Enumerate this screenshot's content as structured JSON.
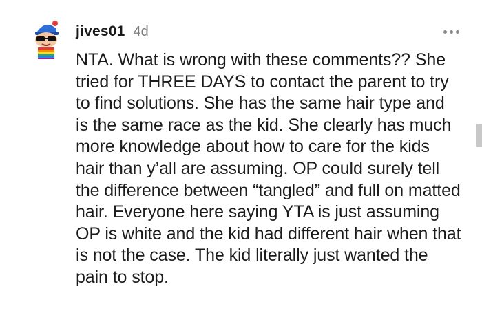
{
  "comment": {
    "username": "jives01",
    "timestamp": "4d",
    "avatar_icon": "snoo-avatar-icon",
    "more_icon": "more-options-icon",
    "text": "NTA. What is wrong with these comments?? She tried for THREE DAYS to contact the parent to try to find solutions. She has the same hair type and is the same race as the kid. She clearly has much more knowledge about how to care for the kids hair than y’all are assuming. OP could surely tell the difference between “tangled” and full on matted hair. Everyone here saying YTA is just assuming OP is white and the kid had different hair when that is not the case. The kid literally just wanted the pain to stop."
  },
  "colors": {
    "username": "#1a1a1b",
    "timestamp": "#7c7c7c",
    "body_text": "#1c1c1c",
    "icon_gray": "#878a8c"
  }
}
